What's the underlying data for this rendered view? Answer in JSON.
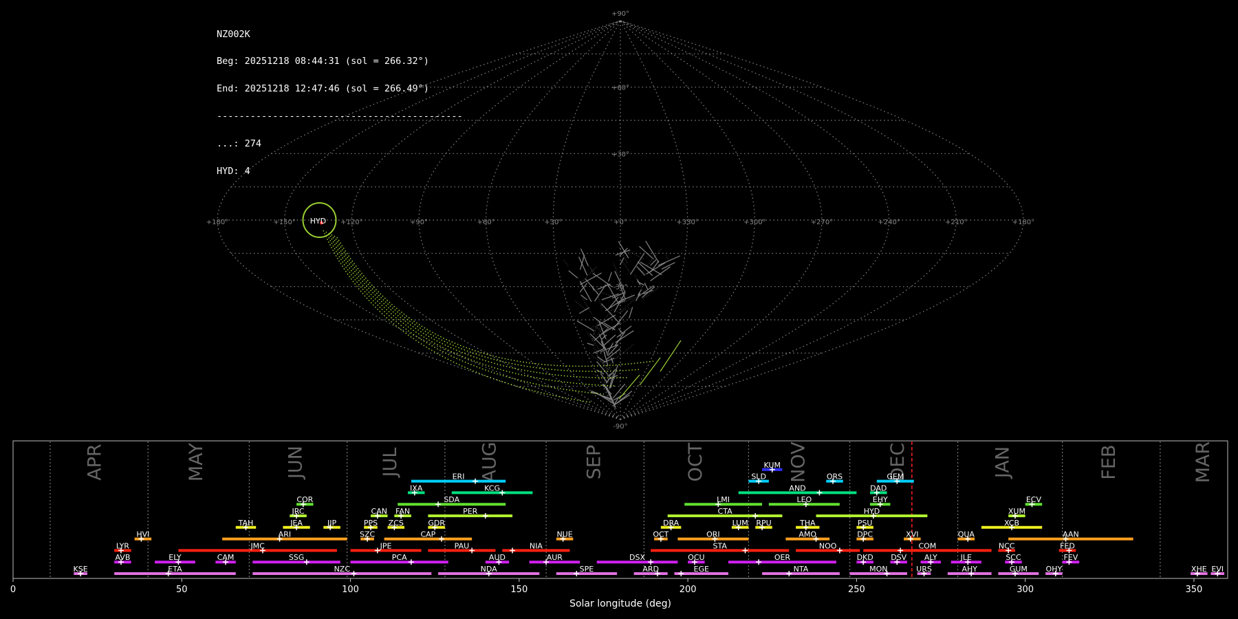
{
  "info": {
    "station": "NZ002K",
    "begin": "Beg: 20251218 08:44:31 (sol = 266.32°)",
    "end": "End: 20251218 12:47:46 (sol = 266.49°)",
    "separator": "--------------------------------------------",
    "sporadic": "...: 274",
    "shower": "HYD: 4"
  },
  "colors": {
    "background": "#000000",
    "grid": "#888888",
    "sporadic_tracks": "#8a8a8a",
    "hyd_tracks": "#9acd32",
    "current_marker": "#ff2020"
  },
  "chart_data": [
    {
      "type": "scatter",
      "projection": "sinusoidal sky map (radiant longitude / latitude)",
      "lat_labels": [
        "+90°",
        "+60°",
        "+30°",
        "-30°",
        "-90°"
      ],
      "lon_labels": [
        "+180°",
        "+150°",
        "+120°",
        "+90°",
        "+60°",
        "+30°",
        "+0°",
        "+330°",
        "+300°",
        "+270°",
        "+240°",
        "+210°",
        "+180°"
      ],
      "radiant": {
        "label": "HYD",
        "lon": 135,
        "lat": 0
      },
      "series": [
        {
          "name": "...",
          "count": 274
        },
        {
          "name": "HYD",
          "count": 4
        }
      ]
    },
    {
      "type": "timeline",
      "xlabel": "Solar longitude (deg)",
      "xlim": [
        0,
        360
      ],
      "xticks": [
        "0",
        "50",
        "100",
        "150",
        "200",
        "250",
        "300",
        "350"
      ],
      "current_sol": 266.4,
      "months": [
        {
          "name": "APR",
          "start": 11,
          "mid": 24.5
        },
        {
          "name": "MAY",
          "start": 40,
          "mid": 54.5
        },
        {
          "name": "JUN",
          "start": 70,
          "mid": 84
        },
        {
          "name": "JUL",
          "start": 99,
          "mid": 112
        },
        {
          "name": "AUG",
          "start": 128,
          "mid": 141.5
        },
        {
          "name": "SEP",
          "start": 158,
          "mid": 172.5
        },
        {
          "name": "OCT",
          "start": 187,
          "mid": 202.5
        },
        {
          "name": "NOV",
          "start": 218,
          "mid": 233
        },
        {
          "name": "DEC",
          "start": 248,
          "mid": 262.5
        },
        {
          "name": "JAN",
          "start": 280,
          "mid": 293.5
        },
        {
          "name": "FEB",
          "start": 311,
          "mid": 325
        },
        {
          "name": "MAR",
          "start": 340,
          "mid": 353
        }
      ],
      "showers": [
        {
          "code": "KUM",
          "start": 222,
          "end": 228,
          "peak": 225,
          "row": 10,
          "color": "#3030ff"
        },
        {
          "code": "ERI",
          "start": 118,
          "end": 146,
          "peak": 137,
          "row": 9,
          "color": "#00d0ff"
        },
        {
          "code": "SLD",
          "start": 218,
          "end": 224,
          "peak": 221,
          "row": 9,
          "color": "#00d0ff"
        },
        {
          "code": "ORS",
          "start": 241,
          "end": 246,
          "peak": 243,
          "row": 9,
          "color": "#00d0ff"
        },
        {
          "code": "GEM",
          "start": 256,
          "end": 267,
          "peak": 262,
          "row": 9,
          "color": "#00d0ff"
        },
        {
          "code": "IXA",
          "start": 117,
          "end": 122,
          "peak": 119,
          "row": 8,
          "color": "#00e080"
        },
        {
          "code": "KCG",
          "start": 130,
          "end": 154,
          "peak": 145,
          "row": 8,
          "color": "#00e080"
        },
        {
          "code": "AND",
          "start": 215,
          "end": 250,
          "peak": 239,
          "row": 8,
          "color": "#00e080"
        },
        {
          "code": "DAD",
          "start": 254,
          "end": 259,
          "peak": 256,
          "row": 8,
          "color": "#00e080"
        },
        {
          "code": "COR",
          "start": 84,
          "end": 89,
          "peak": 86,
          "row": 7,
          "color": "#60e030"
        },
        {
          "code": "SDA",
          "start": 114,
          "end": 146,
          "peak": 126,
          "row": 7,
          "color": "#60e030"
        },
        {
          "code": "LMI",
          "start": 199,
          "end": 222,
          "peak": 209,
          "row": 7,
          "color": "#60e030"
        },
        {
          "code": "LEO",
          "start": 224,
          "end": 245,
          "peak": 235,
          "row": 7,
          "color": "#60e030"
        },
        {
          "code": "EHY",
          "start": 254,
          "end": 260,
          "peak": 257,
          "row": 7,
          "color": "#60e030"
        },
        {
          "code": "ECV",
          "start": 300,
          "end": 305,
          "peak": 302,
          "row": 7,
          "color": "#60e030"
        },
        {
          "code": "JRC",
          "start": 82,
          "end": 87,
          "peak": 84,
          "row": 6,
          "color": "#b0f030"
        },
        {
          "code": "CAN",
          "start": 106,
          "end": 111,
          "peak": 108,
          "row": 6,
          "color": "#b0f030"
        },
        {
          "code": "FAN",
          "start": 113,
          "end": 118,
          "peak": 115,
          "row": 6,
          "color": "#b0f030"
        },
        {
          "code": "PER",
          "start": 123,
          "end": 148,
          "peak": 140,
          "row": 6,
          "color": "#b0f030"
        },
        {
          "code": "CTA",
          "start": 194,
          "end": 228,
          "peak": 220,
          "row": 6,
          "color": "#b0f030"
        },
        {
          "code": "HYD",
          "start": 238,
          "end": 271,
          "peak": 255,
          "row": 6,
          "color": "#b0f030"
        },
        {
          "code": "XUM",
          "start": 295,
          "end": 300,
          "peak": 297,
          "row": 6,
          "color": "#b0f030"
        },
        {
          "code": "TAH",
          "start": 66,
          "end": 72,
          "peak": 69,
          "row": 5,
          "color": "#f0f020"
        },
        {
          "code": "JEA",
          "start": 80,
          "end": 88,
          "peak": 84,
          "row": 5,
          "color": "#f0f020"
        },
        {
          "code": "JJP",
          "start": 92,
          "end": 97,
          "peak": 94,
          "row": 5,
          "color": "#f0f020"
        },
        {
          "code": "PPS",
          "start": 104,
          "end": 108,
          "peak": 106,
          "row": 5,
          "color": "#f0f020"
        },
        {
          "code": "ZCS",
          "start": 111,
          "end": 116,
          "peak": 113,
          "row": 5,
          "color": "#f0f020"
        },
        {
          "code": "GDR",
          "start": 123,
          "end": 128,
          "peak": 125,
          "row": 5,
          "color": "#f0f020"
        },
        {
          "code": "DRA",
          "start": 192,
          "end": 198,
          "peak": 195,
          "row": 5,
          "color": "#f0f020"
        },
        {
          "code": "LUM",
          "start": 213,
          "end": 218,
          "peak": 215,
          "row": 5,
          "color": "#f0f020"
        },
        {
          "code": "RPU",
          "start": 220,
          "end": 225,
          "peak": 222,
          "row": 5,
          "color": "#f0f020"
        },
        {
          "code": "THA",
          "start": 232,
          "end": 239,
          "peak": 235,
          "row": 5,
          "color": "#f0f020"
        },
        {
          "code": "PSU",
          "start": 250,
          "end": 255,
          "peak": 252,
          "row": 5,
          "color": "#f0f020"
        },
        {
          "code": "XCB",
          "start": 287,
          "end": 305,
          "peak": 296,
          "row": 5,
          "color": "#f0f020"
        },
        {
          "code": "HVI",
          "start": 36,
          "end": 41,
          "peak": 38,
          "row": 4,
          "color": "#ffa020"
        },
        {
          "code": "ARI",
          "start": 62,
          "end": 99,
          "peak": 79,
          "row": 4,
          "color": "#ffa020"
        },
        {
          "code": "SZC",
          "start": 103,
          "end": 107,
          "peak": 105,
          "row": 4,
          "color": "#ffa020"
        },
        {
          "code": "CAP",
          "start": 110,
          "end": 136,
          "peak": 127,
          "row": 4,
          "color": "#ffa020"
        },
        {
          "code": "NUE",
          "start": 161,
          "end": 166,
          "peak": 163,
          "row": 4,
          "color": "#ffa020"
        },
        {
          "code": "OCT",
          "start": 190,
          "end": 194,
          "peak": 192,
          "row": 4,
          "color": "#ffa020"
        },
        {
          "code": "ORI",
          "start": 197,
          "end": 218,
          "peak": 208,
          "row": 4,
          "color": "#ffa020"
        },
        {
          "code": "AMO",
          "start": 229,
          "end": 242,
          "peak": 238,
          "row": 4,
          "color": "#ffa020"
        },
        {
          "code": "DPC",
          "start": 250,
          "end": 255,
          "peak": 252,
          "row": 4,
          "color": "#ffa020"
        },
        {
          "code": "XVI",
          "start": 264,
          "end": 269,
          "peak": 266,
          "row": 4,
          "color": "#ffa020"
        },
        {
          "code": "QUA",
          "start": 280,
          "end": 285,
          "peak": 283,
          "row": 4,
          "color": "#ffa020"
        },
        {
          "code": "AAN",
          "start": 295,
          "end": 332,
          "peak": 312,
          "row": 4,
          "color": "#ffa020"
        },
        {
          "code": "LYR",
          "start": 30,
          "end": 35,
          "peak": 32,
          "row": 3,
          "color": "#ff2010"
        },
        {
          "code": "JMC",
          "start": 49,
          "end": 96,
          "peak": 74,
          "row": 3,
          "color": "#ff2010"
        },
        {
          "code": "JPE",
          "start": 100,
          "end": 121,
          "peak": 108,
          "row": 3,
          "color": "#ff2010"
        },
        {
          "code": "PAU",
          "start": 123,
          "end": 143,
          "peak": 136,
          "row": 3,
          "color": "#ff2010"
        },
        {
          "code": "NIA",
          "start": 145,
          "end": 165,
          "peak": 148,
          "row": 3,
          "color": "#ff2010"
        },
        {
          "code": "STA",
          "start": 189,
          "end": 230,
          "peak": 217,
          "row": 3,
          "color": "#ff2010"
        },
        {
          "code": "NOO",
          "start": 232,
          "end": 251,
          "peak": 245,
          "row": 3,
          "color": "#ff2010"
        },
        {
          "code": "COM",
          "start": 252,
          "end": 290,
          "peak": 263,
          "row": 3,
          "color": "#ff2010"
        },
        {
          "code": "NCC",
          "start": 292,
          "end": 297,
          "peak": 295,
          "row": 3,
          "color": "#ff2010"
        },
        {
          "code": "FED",
          "start": 310,
          "end": 315,
          "peak": 313,
          "row": 3,
          "color": "#ff2010"
        },
        {
          "code": "AVB",
          "start": 30,
          "end": 35,
          "peak": 32,
          "row": 2,
          "color": "#d020f0"
        },
        {
          "code": "ELY",
          "start": 42,
          "end": 54,
          "peak": 49,
          "row": 2,
          "color": "#d020f0"
        },
        {
          "code": "CAM",
          "start": 60,
          "end": 66,
          "peak": 63,
          "row": 2,
          "color": "#d020f0"
        },
        {
          "code": "SSG",
          "start": 71,
          "end": 97,
          "peak": 87,
          "row": 2,
          "color": "#d020f0"
        },
        {
          "code": "PCA",
          "start": 100,
          "end": 129,
          "peak": 118,
          "row": 2,
          "color": "#d020f0"
        },
        {
          "code": "AUD",
          "start": 140,
          "end": 147,
          "peak": 144,
          "row": 2,
          "color": "#d020f0"
        },
        {
          "code": "AUR",
          "start": 153,
          "end": 168,
          "peak": 158,
          "row": 2,
          "color": "#d020f0"
        },
        {
          "code": "DSX",
          "start": 173,
          "end": 197,
          "peak": 189,
          "row": 2,
          "color": "#d020f0"
        },
        {
          "code": "OCU",
          "start": 200,
          "end": 205,
          "peak": 202,
          "row": 2,
          "color": "#d020f0"
        },
        {
          "code": "OER",
          "start": 212,
          "end": 244,
          "peak": 221,
          "row": 2,
          "color": "#d020f0"
        },
        {
          "code": "DKD",
          "start": 250,
          "end": 255,
          "peak": 252,
          "row": 2,
          "color": "#d020f0"
        },
        {
          "code": "DSV",
          "start": 260,
          "end": 265,
          "peak": 262,
          "row": 2,
          "color": "#d020f0"
        },
        {
          "code": "ALY",
          "start": 269,
          "end": 275,
          "peak": 272,
          "row": 2,
          "color": "#d020f0"
        },
        {
          "code": "JLE",
          "start": 278,
          "end": 287,
          "peak": 283,
          "row": 2,
          "color": "#d020f0"
        },
        {
          "code": "SCC",
          "start": 294,
          "end": 299,
          "peak": 296,
          "row": 2,
          "color": "#d020f0"
        },
        {
          "code": "FEV",
          "start": 311,
          "end": 316,
          "peak": 313,
          "row": 2,
          "color": "#d020f0"
        },
        {
          "code": "KSE",
          "start": 18,
          "end": 22,
          "peak": 20,
          "row": 1,
          "color": "#e070e0"
        },
        {
          "code": "ETA",
          "start": 30,
          "end": 66,
          "peak": 46,
          "row": 1,
          "color": "#e070e0"
        },
        {
          "code": "NZC",
          "start": 71,
          "end": 124,
          "peak": 101,
          "row": 1,
          "color": "#e070e0"
        },
        {
          "code": "NDA",
          "start": 126,
          "end": 156,
          "peak": 141,
          "row": 1,
          "color": "#e070e0"
        },
        {
          "code": "SPE",
          "start": 161,
          "end": 179,
          "peak": 167,
          "row": 1,
          "color": "#e070e0"
        },
        {
          "code": "ARD",
          "start": 184,
          "end": 194,
          "peak": 191,
          "row": 1,
          "color": "#e070e0"
        },
        {
          "code": "EGE",
          "start": 196,
          "end": 212,
          "peak": 198,
          "row": 1,
          "color": "#e070e0"
        },
        {
          "code": "NTA",
          "start": 222,
          "end": 245,
          "peak": 230,
          "row": 1,
          "color": "#e070e0"
        },
        {
          "code": "MON",
          "start": 248,
          "end": 265,
          "peak": 259,
          "row": 1,
          "color": "#e070e0"
        },
        {
          "code": "URS",
          "start": 268,
          "end": 272,
          "peak": 270,
          "row": 1,
          "color": "#e070e0"
        },
        {
          "code": "AHY",
          "start": 277,
          "end": 290,
          "peak": 284,
          "row": 1,
          "color": "#e070e0"
        },
        {
          "code": "GUM",
          "start": 292,
          "end": 304,
          "peak": 297,
          "row": 1,
          "color": "#e070e0"
        },
        {
          "code": "OHY",
          "start": 306,
          "end": 311,
          "peak": 309,
          "row": 1,
          "color": "#e070e0"
        },
        {
          "code": "XHE",
          "start": 349,
          "end": 354,
          "peak": 351,
          "row": 1,
          "color": "#e070e0"
        },
        {
          "code": "EVI",
          "start": 355,
          "end": 359,
          "peak": 357,
          "row": 1,
          "color": "#e070e0"
        }
      ]
    }
  ]
}
